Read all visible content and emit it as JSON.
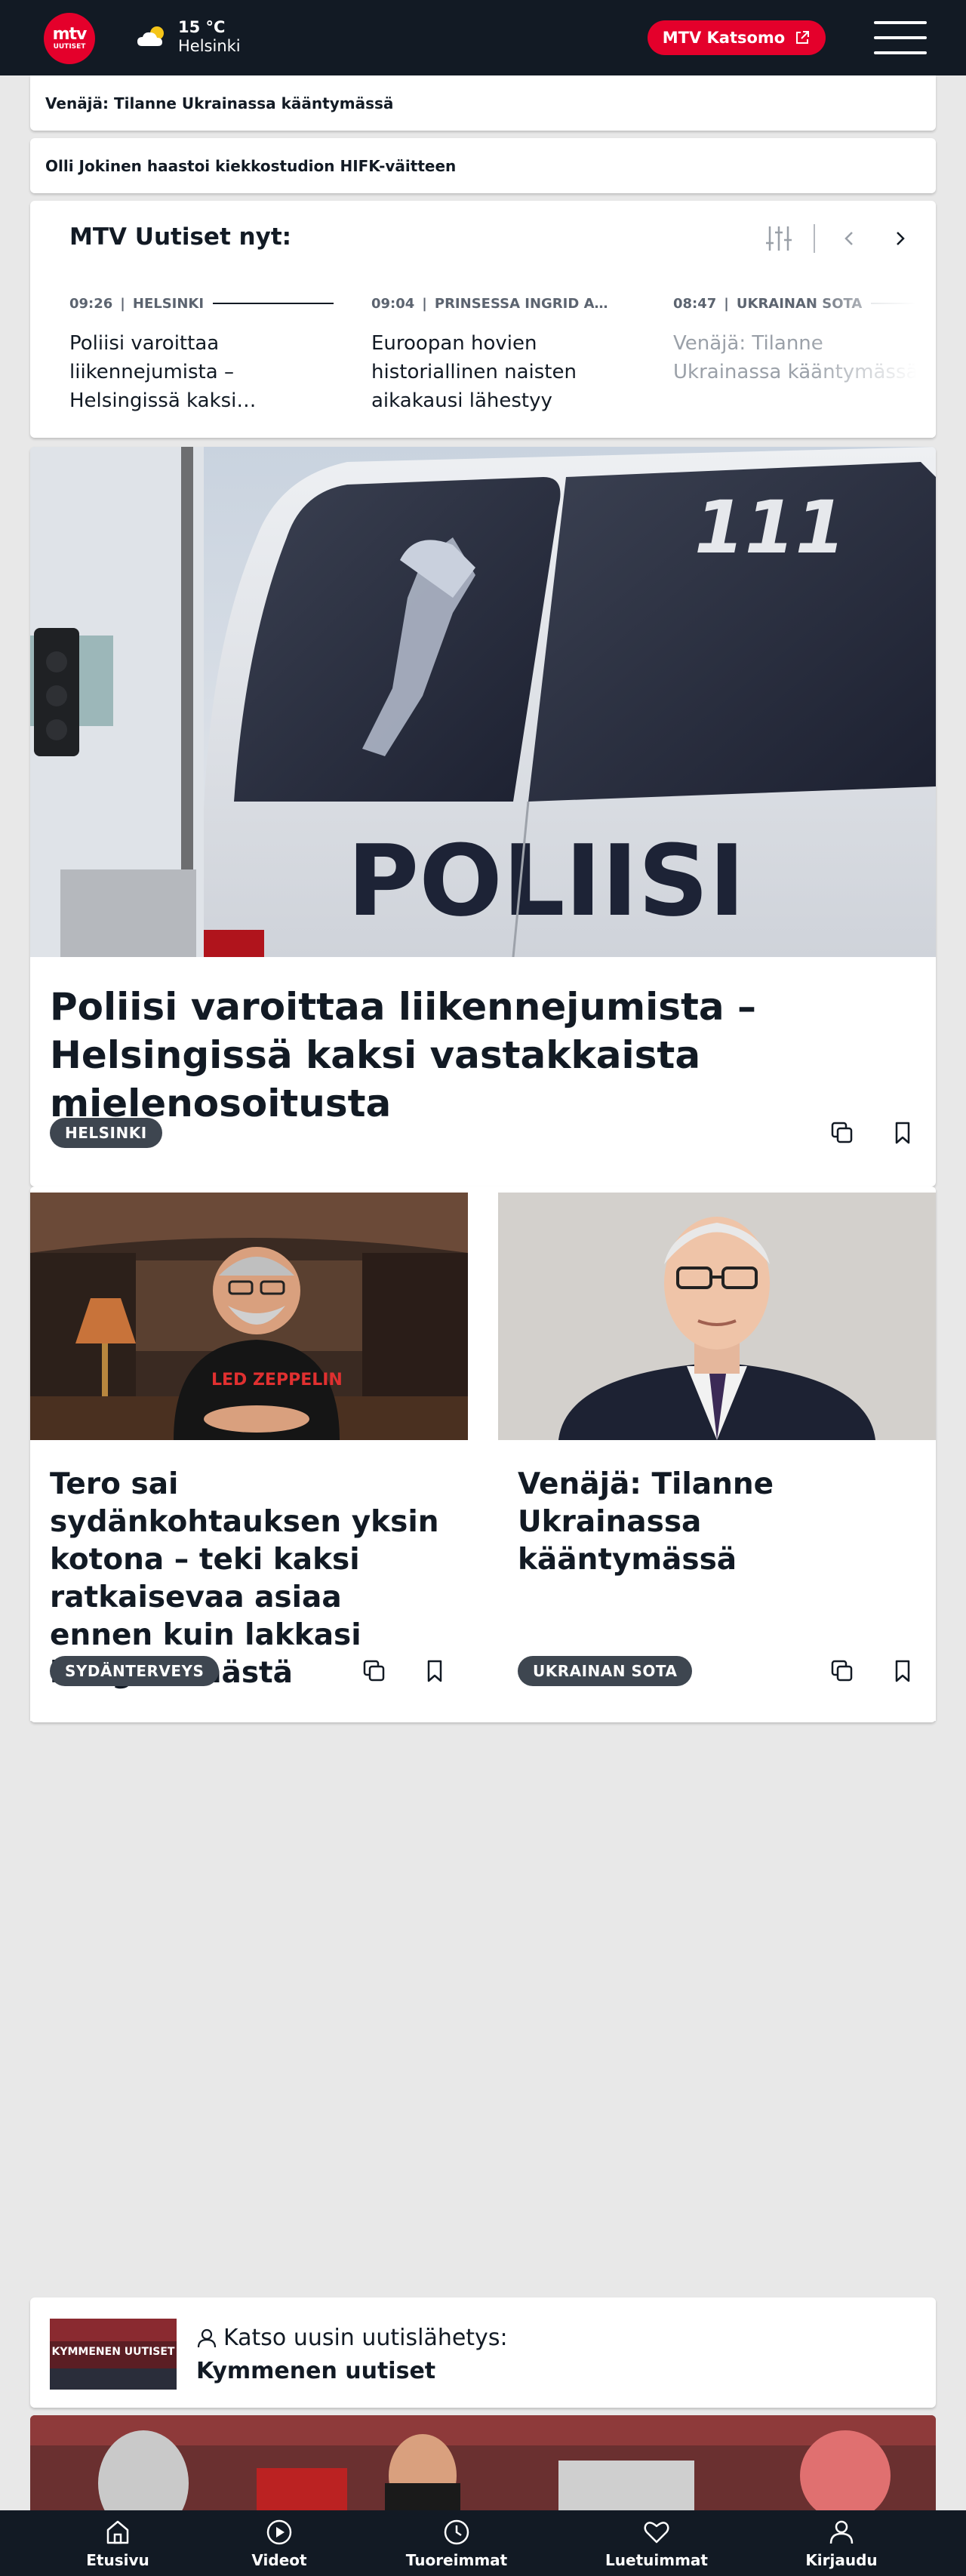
{
  "header": {
    "logo_line1": "mtv",
    "logo_line2": "UUTISET",
    "weather_temp": "15 °C",
    "weather_city": "Helsinki",
    "weather_icon": "partly-cloudy-icon",
    "katsomo_label": "MTV Katsomo",
    "accent_color": "#e4002b",
    "bg_color": "#121a24"
  },
  "breaking": [
    {
      "text": "Venäjä: Tilanne Ukrainassa kääntymässä"
    },
    {
      "text": "Olli Jokinen haastoi kiekkostudion HIFK-väitteen"
    }
  ],
  "now": {
    "title": "MTV Uutiset nyt:",
    "items": [
      {
        "time": "09:26",
        "category": "HELSINKI",
        "headline": "Poliisi varoittaa liikennejumista – Helsingissä kaksi…"
      },
      {
        "time": "09:04",
        "category": "PRINSESSA INGRID A…",
        "headline": "Euroopan hovien historiallinen naisten aikakausi lähestyy"
      },
      {
        "time": "08:47",
        "category": "UKRAINAN SOTA",
        "headline": "Venäjä: Tilanne Ukrainassa kääntymässä"
      }
    ]
  },
  "hero": {
    "image_text": "POLIISI",
    "image_number": "111",
    "title": "Poliisi varoittaa liikennejumista – Helsingissä kaksi vastakkaista mielenosoitusta",
    "tag": "HELSINKI"
  },
  "cards": [
    {
      "title": "Tero sai sydänkohtauksen yksin kotona – teki kaksi ratkaisevaa asiaa ennen kuin lakkasi hengittämästä",
      "tag": "SYDÄNTERVEYS",
      "image_shirt_text": "LED ZEPPELIN"
    },
    {
      "title": "Venäjä: Tilanne Ukrainassa kääntymässä",
      "tag": "UKRAINAN SOTA"
    }
  ],
  "newsbox": {
    "thumb_text": "KYMMENEN UUTISET",
    "line1": "Katso uusin uutislähetys:",
    "line2": "Kymmenen uutiset"
  },
  "nav": [
    {
      "label": "Etusivu",
      "icon": "home-icon"
    },
    {
      "label": "Videot",
      "icon": "play-icon"
    },
    {
      "label": "Tuoreimmat",
      "icon": "clock-icon"
    },
    {
      "label": "Luetuimmat",
      "icon": "heart-icon"
    },
    {
      "label": "Kirjaudu",
      "icon": "user-icon"
    }
  ]
}
